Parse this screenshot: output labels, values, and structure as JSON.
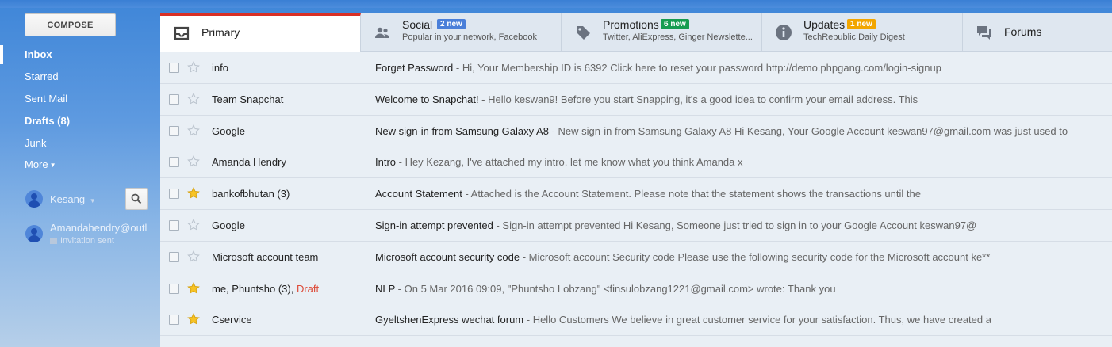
{
  "sidebar": {
    "compose_label": "COMPOSE",
    "nav": {
      "inbox": "Inbox",
      "starred": "Starred",
      "sent": "Sent Mail",
      "drafts": "Drafts (8)",
      "junk": "Junk",
      "more": "More"
    },
    "contacts": {
      "self_name": "Kesang",
      "other_name": "Amandahendry@outl",
      "other_status": "Invitation sent"
    }
  },
  "tabs": [
    {
      "title": "Primary",
      "subtitle": "",
      "badge": ""
    },
    {
      "title": "Social",
      "subtitle": "Popular in your network, Facebook",
      "badge": "2 new",
      "badge_color": "#4a7fd9"
    },
    {
      "title": "Promotions",
      "subtitle": "Twitter, AliExpress, Ginger Newslette...",
      "badge": "6 new",
      "badge_color": "#169c50"
    },
    {
      "title": "Updates",
      "subtitle": "TechRepublic Daily Digest",
      "badge": "1 new",
      "badge_color": "#f2a600"
    },
    {
      "title": "Forums",
      "subtitle": "",
      "badge": ""
    }
  ],
  "emails": [
    {
      "sender": "info",
      "draft": "",
      "starred": false,
      "subject": "Forget Password",
      "snippet": " - Hi, Your Membership ID is 6392 Click here to reset your password http://demo.phpgang.com/login-signup"
    },
    {
      "sender": "Team Snapchat",
      "draft": "",
      "starred": false,
      "subject": "Welcome to Snapchat!",
      "snippet": " - Hello keswan9! Before you start Snapping, it's a good idea to confirm your email address. This"
    },
    {
      "sender": "Google",
      "draft": "",
      "starred": false,
      "subject": "New sign-in from Samsung Galaxy A8",
      "snippet": " - New sign-in from Samsung Galaxy A8 Hi Kesang, Your Google Account keswan97@gmail.com was just used to"
    },
    {
      "sender": "Amanda Hendry",
      "draft": "",
      "starred": false,
      "subject": "Intro",
      "snippet": " - Hey Kezang, I've attached my intro, let me know what you think Amanda x"
    },
    {
      "sender": "bankofbhutan (3)",
      "draft": "",
      "starred": true,
      "subject": "Account Statement",
      "snippet": " - Attached is the Account Statement. Please note that the statement shows the transactions until the"
    },
    {
      "sender": "Google",
      "draft": "",
      "starred": false,
      "subject": "Sign-in attempt prevented",
      "snippet": " - Sign-in attempt prevented Hi Kesang, Someone just tried to sign in to your Google Account keswan97@"
    },
    {
      "sender": "Microsoft account team",
      "draft": "",
      "starred": false,
      "subject": "Microsoft account security code",
      "snippet": " - Microsoft account Security code Please use the following security code for the Microsoft account ke**"
    },
    {
      "sender": "me, Phuntsho (3), ",
      "draft": "Draft",
      "starred": true,
      "subject": "NLP",
      "snippet": " - On 5 Mar 2016 09:09, \"Phuntsho Lobzang\" <finsulobzang1221@gmail.com> wrote: Thank you"
    },
    {
      "sender": "Cservice",
      "draft": "",
      "starred": true,
      "subject": "GyeltshenExpress wechat forum",
      "snippet": " - Hello Customers We believe in great customer service for your satisfaction. Thus, we have created a"
    }
  ],
  "colors": {
    "star_on": "#f7c325",
    "star_off": "#b9c2cc",
    "draft": "#dd4b39",
    "active_tab_accent": "#d93025"
  }
}
